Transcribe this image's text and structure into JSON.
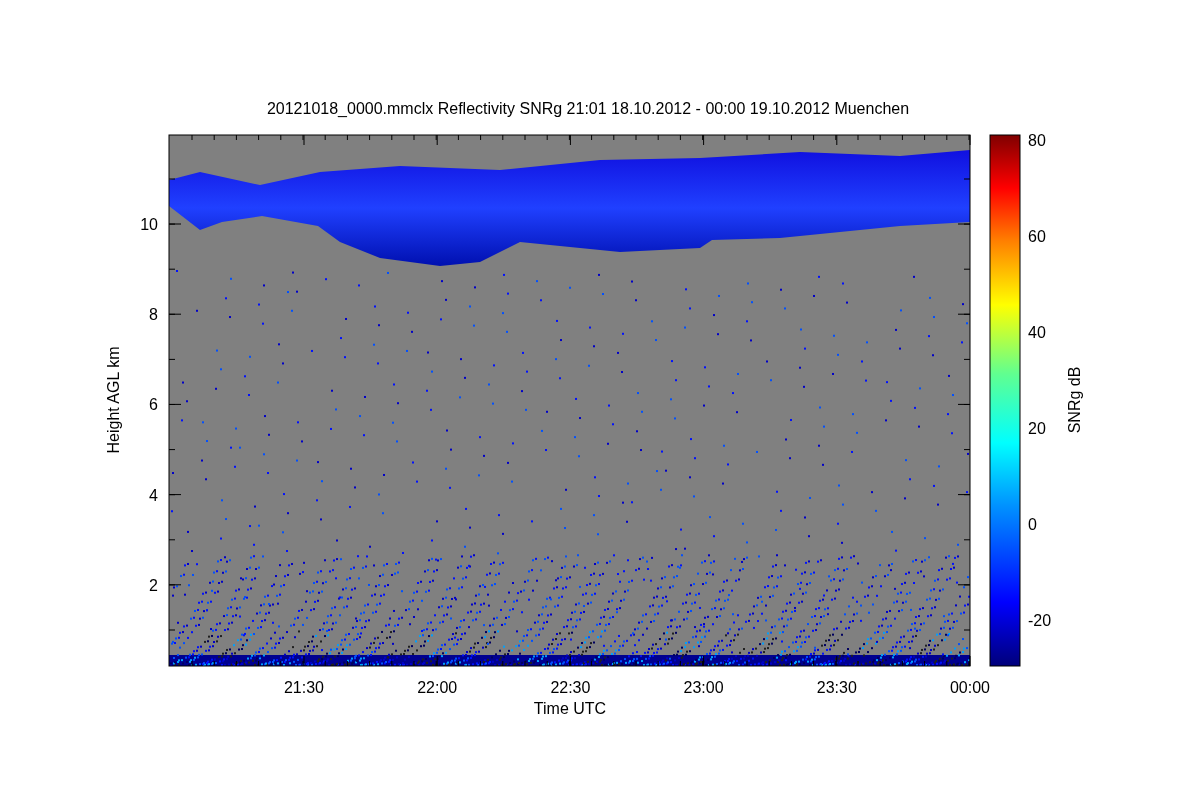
{
  "title": "20121018_0000.mmclx Reflectivity SNRg   21:01 18.10.2012 - 00:00 19.10.2012 Muenchen",
  "xlabel": "Time UTC",
  "ylabel": "Height AGL km",
  "xticks": [
    "21:30",
    "22:00",
    "22:30",
    "23:00",
    "23:30",
    "00:00"
  ],
  "yticks": [
    "10",
    "8",
    "6",
    "4",
    "2"
  ],
  "colorbar": {
    "label": "SNRg dB",
    "ticks": [
      "80",
      "60",
      "40",
      "20",
      "0",
      "-20"
    ]
  }
}
